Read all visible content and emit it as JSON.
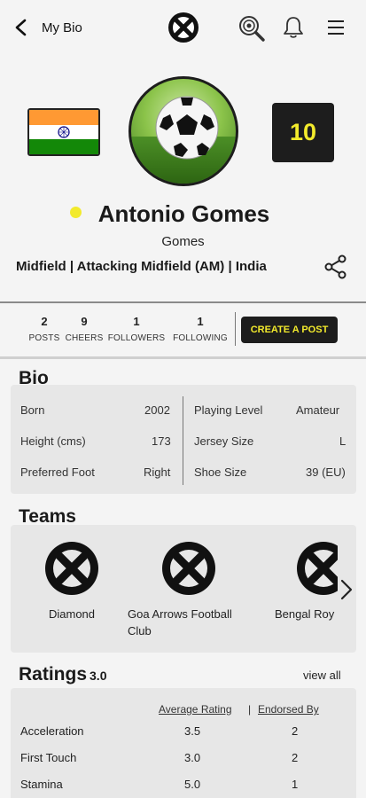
{
  "header": {
    "back_label": "My Bio",
    "icons": [
      "back-chevron-icon",
      "app-logo-icon",
      "search-icon",
      "bell-icon",
      "menu-icon"
    ]
  },
  "profile": {
    "jersey_number": "10",
    "name": "Antonio Gomes",
    "short_name": "Gomes",
    "positions": "Midfield  |  Attacking Midfield (AM)  |  India",
    "status_color": "#f2ea2c",
    "flag": "india-flag"
  },
  "stats": {
    "posts": {
      "value": "2",
      "label": "POSTS"
    },
    "cheers": {
      "value": "9",
      "label": "CHEERS"
    },
    "followers": {
      "value": "1",
      "label": "FOLLOWERS"
    },
    "following": {
      "value": "1",
      "label": "FOLLOWING"
    },
    "create_post": "CREATE A POST"
  },
  "bio": {
    "title": "Bio",
    "left": [
      {
        "label": "Born",
        "value": "2002"
      },
      {
        "label": "Height (cms)",
        "value": "173"
      },
      {
        "label": "Preferred Foot",
        "value": "Right"
      }
    ],
    "right": [
      {
        "label": "Playing Level",
        "value": "Amateur"
      },
      {
        "label": "Jersey Size",
        "value": "L"
      },
      {
        "label": "Shoe Size",
        "value": "39 (EU)"
      }
    ]
  },
  "teams": {
    "title": "Teams",
    "items": [
      {
        "name": "Diamond"
      },
      {
        "name": "Goa Arrows Football Club"
      },
      {
        "name": "Bengal Roy"
      }
    ]
  },
  "ratings": {
    "title": "Ratings",
    "overall": "3.0",
    "view_all": "view all",
    "col_avg": "Average Rating",
    "col_sep": "|",
    "col_endorsed": "Endorsed By",
    "rows": [
      {
        "skill": "Acceleration",
        "avg": "3.5",
        "endorsed": "2"
      },
      {
        "skill": "First Touch",
        "avg": "3.0",
        "endorsed": "2"
      },
      {
        "skill": "Stamina",
        "avg": "5.0",
        "endorsed": "1"
      }
    ]
  },
  "colors": {
    "accent": "#f2ea2c",
    "dark": "#1d1d1d",
    "card": "#e7e7e7"
  }
}
